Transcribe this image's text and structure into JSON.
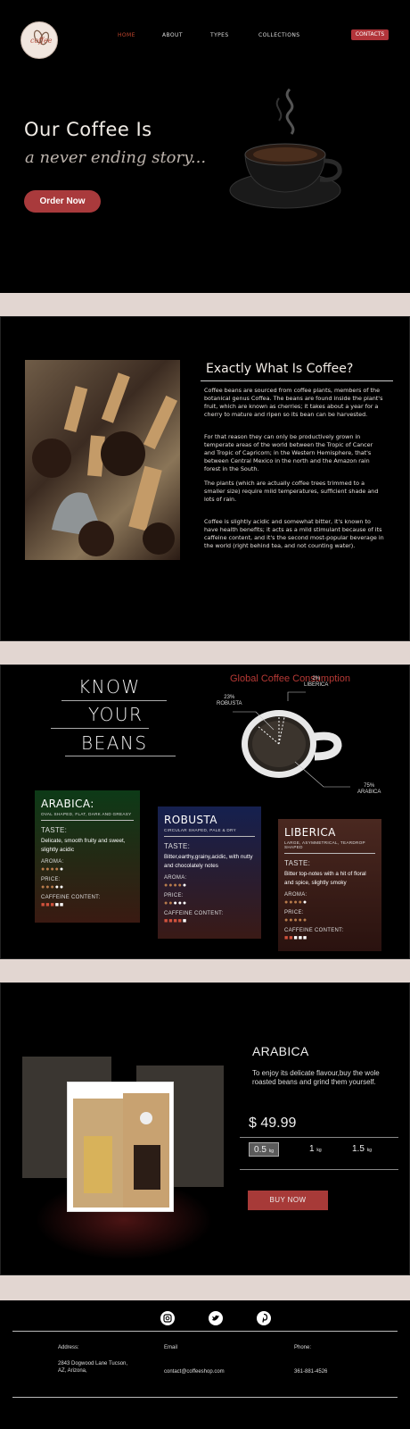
{
  "header": {
    "logo_text": "coffee",
    "nav": [
      "HOME",
      "ABOUT",
      "TYPES",
      "COLLECTIONS"
    ],
    "contact_label": "CONTACTS"
  },
  "hero": {
    "title": "Our Coffee Is",
    "subtitle": "a never ending story...",
    "order_label": "Order Now"
  },
  "about": {
    "title": "Exactly What Is Coffee?",
    "paragraphs": [
      "Coffee beans are sourced from coffee plants, members of the botanical genus Coffea. The beans are found inside the plant's fruit, which are known as cherries; it takes about a year for a cherry to mature and ripen so its bean can be harvested.",
      "For that reason they can only be productively grown in temperate areas of the world between the Tropic of Cancer and Tropic of Capricorn; in the Western Hemisphere, that's between Central Mexico in the north and the Amazon rain forest in the South.",
      "The plants (which are actually coffee trees trimmed to a smaller size) require mild temperatures, sufficient shade and lots of rain.",
      "Coffee is slightly acidic and somewhat bitter, it's known to have health benefits; it acts as a mild stimulant because of its caffeine content, and it's the second most-popular beverage in the world (right behind tea, and not counting water)."
    ]
  },
  "beans": {
    "heading": [
      "KNOW",
      "YOUR",
      "BEANS"
    ],
    "consumption_title": "Global Coffee Consumption",
    "consumption": [
      {
        "percent": "2%",
        "name": "LIBERICA"
      },
      {
        "percent": "23%",
        "name": "ROBUSTA"
      },
      {
        "percent": "75%",
        "name": "ARABICA"
      }
    ],
    "cards": [
      {
        "name": "ARABICA:",
        "desc": "OVAL SHAPED, FLAT, DARK AND GREASY",
        "taste_label": "TASTE:",
        "taste": "Delicate, smooth fruity and sweet, slightly acidic",
        "aroma_label": "AROMA:",
        "price_label": "PRICE:",
        "caffeine_label": "CAFFEINE CONTENT:",
        "color": "#0d3a17"
      },
      {
        "name": "ROBUSTA",
        "desc": "CIRCULAR SHAPED, PALE & DRY",
        "taste_label": "TASTE:",
        "taste": "Bitter,earthy,grainy,acidic, with nutty and chocolately notes",
        "aroma_label": "AROMA:",
        "price_label": "PRICE:",
        "caffeine_label": "CAFFEINE CONTENT:",
        "color": "#15204f"
      },
      {
        "name": "LIBERICA",
        "desc": "LARGE, ASYMMETRICAL, TEARDROP SHAPED",
        "taste_label": "TASTE:",
        "taste": "Bitter top-notes with a hit of floral and spice, slightly smoky",
        "aroma_label": "AROMA:",
        "price_label": "PRICE:",
        "caffeine_label": "CAFFEINE CONTENT:",
        "color": "#4a2820"
      }
    ]
  },
  "product": {
    "title": "ARABICA",
    "desc": "To enjoy its delicate flavour,buy the wole roasted beans and grind them yourself.",
    "price": "$ 49.99",
    "sizes": [
      {
        "value": "0.5",
        "unit": "kg"
      },
      {
        "value": "1",
        "unit": "kg"
      },
      {
        "value": "1.5",
        "unit": "kg"
      }
    ],
    "buy_label": "BUY NOW"
  },
  "footer": {
    "address_label": "Address:",
    "address": "2843 Dogwood Lane Tucson, AZ, Arizona,",
    "email_label": "Email",
    "email": "contact@coffeeshop.com",
    "phone_label": "Phone:",
    "phone": "361-881-4526"
  },
  "colors": {
    "accent": "#a93a3c",
    "gap": "#e2d6d1",
    "background": "#000000"
  },
  "icons": [
    "instagram-icon",
    "twitter-icon",
    "pinterest-icon"
  ]
}
